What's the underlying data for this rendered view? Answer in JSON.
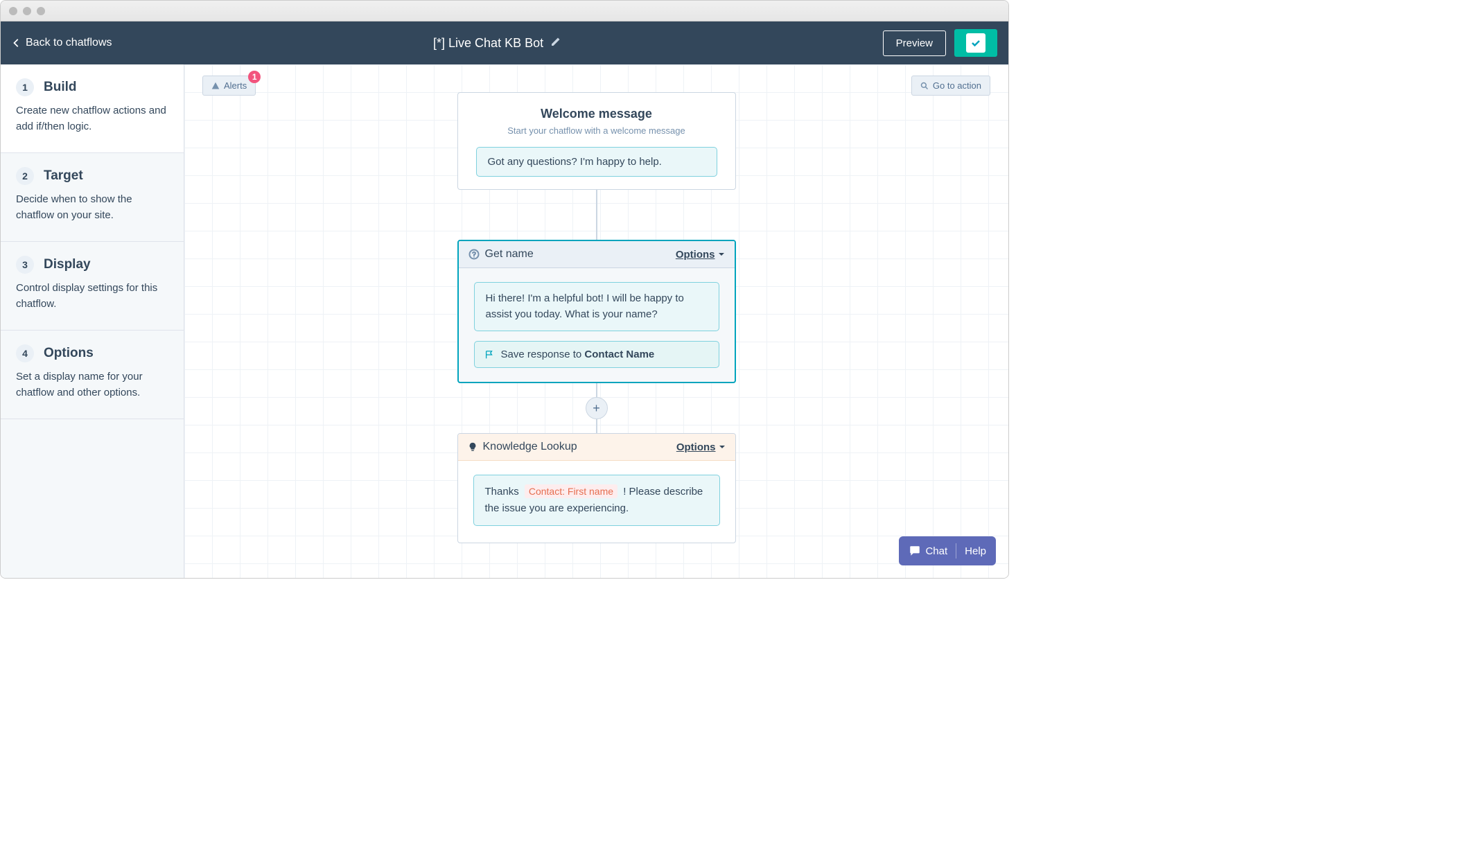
{
  "header": {
    "back_label": "Back to chatflows",
    "title": "[*] Live Chat KB Bot",
    "preview_label": "Preview"
  },
  "sidebar": {
    "steps": [
      {
        "num": "1",
        "title": "Build",
        "desc": "Create new chatflow actions and add if/then logic."
      },
      {
        "num": "2",
        "title": "Target",
        "desc": "Decide when to show the chatflow on your site."
      },
      {
        "num": "3",
        "title": "Display",
        "desc": "Control display settings for this chatflow."
      },
      {
        "num": "4",
        "title": "Options",
        "desc": "Set a display name for your chatflow and other options."
      }
    ]
  },
  "canvas": {
    "alerts_label": "Alerts",
    "alerts_count": "1",
    "goto_label": "Go to action"
  },
  "flow": {
    "welcome": {
      "title": "Welcome message",
      "subtitle": "Start your chatflow with a welcome message",
      "message": "Got any questions? I'm happy to help."
    },
    "getname": {
      "title": "Get name",
      "options_label": "Options",
      "message": "Hi there! I'm a helpful bot!  I will be happy to assist you today. What is your name?",
      "save_prefix": "Save response to ",
      "save_target": "Contact Name"
    },
    "knowledge": {
      "title": "Knowledge Lookup",
      "options_label": "Options",
      "msg_prefix": "Thanks ",
      "token": "Contact: First name",
      "msg_suffix": " ! Please describe the issue you are experiencing."
    }
  },
  "help": {
    "chat_label": "Chat",
    "help_label": "Help"
  }
}
